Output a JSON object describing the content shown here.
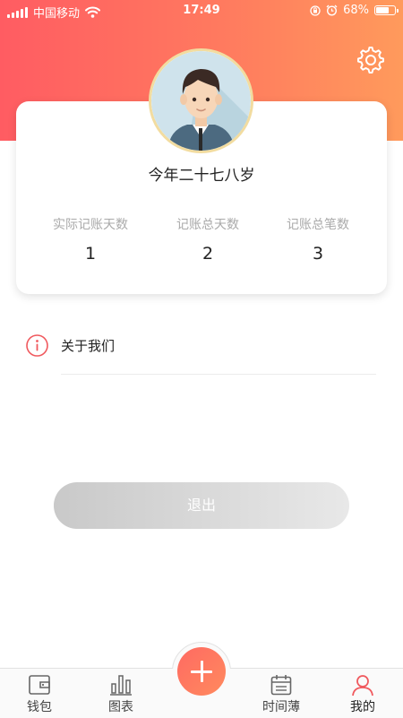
{
  "status_bar": {
    "carrier": "中国移动",
    "time": "17:49",
    "battery": "68%",
    "battery_level": 0.68
  },
  "profile": {
    "age_text": "今年二十七八岁"
  },
  "stats": [
    {
      "label": "实际记账天数",
      "value": "1"
    },
    {
      "label": "记账总天数",
      "value": "2"
    },
    {
      "label": "记账总笔数",
      "value": "3"
    }
  ],
  "menu": {
    "about_label": "关于我们"
  },
  "logout_label": "退出",
  "tabs": [
    {
      "label": "钱包",
      "icon": "wallet-icon",
      "active": false
    },
    {
      "label": "图表",
      "icon": "chart-icon",
      "active": false
    },
    {
      "label": "时间薄",
      "icon": "calendar-icon",
      "active": false
    },
    {
      "label": "我的",
      "icon": "person-icon",
      "active": true
    }
  ],
  "colors": {
    "accent": "#ff6a62",
    "header_gradient_start": "#ff5c62",
    "header_gradient_end": "#ff9a5c",
    "logout_gray": "#d0d0d0"
  }
}
